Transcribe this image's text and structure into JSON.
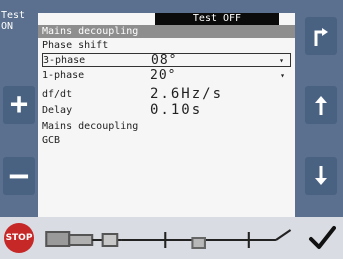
{
  "status_bar": {
    "text": "Test OFF"
  },
  "left_panel": {
    "test_label": "Test ON"
  },
  "screen": {
    "header": "Mains decoupling",
    "section1_title": "Phase shift",
    "rows": [
      {
        "label": "3-phase",
        "value": "08°"
      },
      {
        "label": "1-phase",
        "value": "20°"
      }
    ],
    "dfdt": {
      "label": "df/dt",
      "value": "2.6Hz/s"
    },
    "delay": {
      "label": "Delay",
      "value": "0.10s"
    },
    "section2_title": "Mains decoupling",
    "section2_value": "GCB"
  },
  "buttons": {
    "left": [
      "plus",
      "minus"
    ],
    "right": [
      "return-arrow",
      "up-arrow",
      "down-arrow"
    ]
  },
  "bottom": {
    "stop_label": "STOP"
  }
}
